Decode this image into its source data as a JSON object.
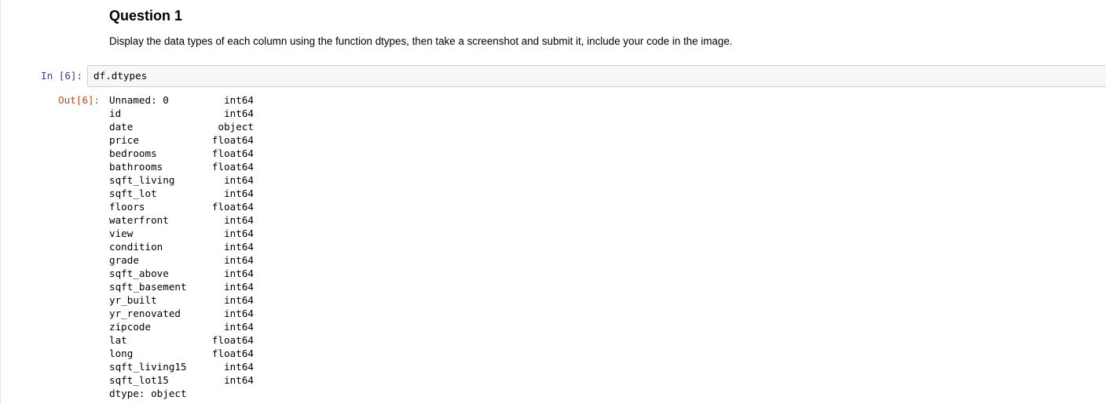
{
  "markdown": {
    "heading": "Question 1",
    "paragraph": "Display the data types of each column using the function dtypes, then take a screenshot and submit it, include your code in the image."
  },
  "code_cell": {
    "in_prompt": "In [6]:",
    "code": "df.dtypes"
  },
  "output": {
    "out_prompt": "Out[6]:",
    "rows": [
      {
        "name": "Unnamed: 0",
        "type": "int64"
      },
      {
        "name": "id",
        "type": "int64"
      },
      {
        "name": "date",
        "type": "object"
      },
      {
        "name": "price",
        "type": "float64"
      },
      {
        "name": "bedrooms",
        "type": "float64"
      },
      {
        "name": "bathrooms",
        "type": "float64"
      },
      {
        "name": "sqft_living",
        "type": "int64"
      },
      {
        "name": "sqft_lot",
        "type": "int64"
      },
      {
        "name": "floors",
        "type": "float64"
      },
      {
        "name": "waterfront",
        "type": "int64"
      },
      {
        "name": "view",
        "type": "int64"
      },
      {
        "name": "condition",
        "type": "int64"
      },
      {
        "name": "grade",
        "type": "int64"
      },
      {
        "name": "sqft_above",
        "type": "int64"
      },
      {
        "name": "sqft_basement",
        "type": "int64"
      },
      {
        "name": "yr_built",
        "type": "int64"
      },
      {
        "name": "yr_renovated",
        "type": "int64"
      },
      {
        "name": "zipcode",
        "type": "int64"
      },
      {
        "name": "lat",
        "type": "float64"
      },
      {
        "name": "long",
        "type": "float64"
      },
      {
        "name": "sqft_living15",
        "type": "int64"
      },
      {
        "name": "sqft_lot15",
        "type": "int64"
      }
    ],
    "footer": "dtype: object"
  },
  "colors": {
    "in_prompt": "#303f9f",
    "out_prompt": "#d84315",
    "input_background": "#f7f7f7",
    "input_border": "#cfcfcf"
  }
}
